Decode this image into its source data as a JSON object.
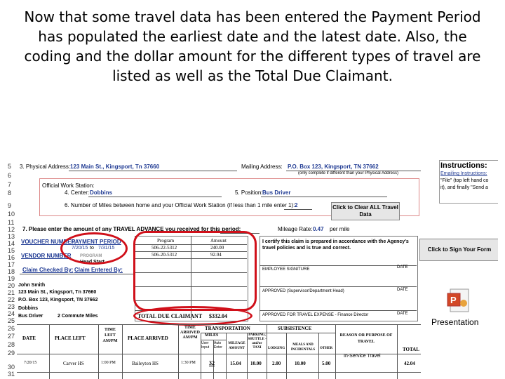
{
  "caption": "Now that some travel data has been entered the Payment Period has populated the earliest date and the latest date. Also, the coding and the dollar amount for the different types of travel are listed as well as the Total Due Claimant.",
  "rows": [
    "5",
    "6",
    "7",
    "8",
    "9",
    "10",
    "11",
    "12",
    "13",
    "14",
    "15",
    "16",
    "17",
    "18",
    "19",
    "20",
    "21",
    "22",
    "23",
    "24",
    "25",
    "26",
    "27",
    "28",
    "29",
    "30",
    "31"
  ],
  "form": {
    "physical_address_label": "3. Physical Address:",
    "physical_address_value": "123 Main St., Kingsport, Tn 37660",
    "mailing_address_label": "Mailing Address:",
    "mailing_address_value": "P.O. Box 123, Kingsport, TN 37662",
    "mailing_note": "(only complete if different than your Physical Address)",
    "official_station": "Official Work Station:",
    "center_label": "4. Center:",
    "center_value": "Dobbins",
    "position_label": "5. Position:",
    "position_value": "Bus Driver",
    "miles_label": "6. Number of Miles between home and your Official Work Station (if less than 1 mile enter 1):",
    "miles_value": "2",
    "advance_label": "7. Please enter the amount of any TRAVEL ADVANCE you received for this period:",
    "mileage_rate_label": "Mileage Rate:",
    "mileage_rate_value": "0.47",
    "per_mile": "per mile"
  },
  "instructions": {
    "title": "Instructions:",
    "emailing": "Emailing Instructions:",
    "line2": "\"File\" (top left hand co",
    "line3": "it), and finally \"Send a"
  },
  "buttons": {
    "clear": "Click to Clear ALL Travel Data",
    "sign": "Click to Sign Your Form"
  },
  "left_panel": {
    "voucher_number": "VOUCHER NUMBER",
    "payment_period": "PAYMENT PERIOD",
    "date_from": "7/20/15",
    "to": "to",
    "date_to": "7/31/15",
    "vendor_number": "VENDOR NUMBER",
    "program_hidden": "PROGRAM",
    "head_start": "Head Start",
    "claim_checked_by": "Claim Checked By:",
    "claim_entered_by": "Claim Entered By:",
    "name": "John Smith",
    "address1": "123 Main St., Kingsport, Tn 37660",
    "address2": "P.O. Box 123, Kingsport, TN 37662",
    "center": "Dobbins",
    "position": "Bus Driver",
    "commute": "2 Commute Miles"
  },
  "coding": {
    "program_header": "Program",
    "amount_header": "Amount",
    "rows": [
      {
        "program": "506-22-5312",
        "amount": "240.00"
      },
      {
        "program": "506-20-5312",
        "amount": "92.04"
      }
    ],
    "total_label": "TOTAL DUE CLAIMANT",
    "total_value": "$332.04"
  },
  "certify": {
    "text": "I certify this claim is prepared in accordance with the Agency's travel policies and is true and correct.",
    "sig1": "EMPLOYEE SIGNITURE",
    "sig2": "APPROVED (Supervisor/Department Head)",
    "sig3": "APPROVED FOR TRAVEL EXPENSE - Finance Director",
    "date": "DATE"
  },
  "presentation": {
    "label": "Presentation"
  },
  "travel_table": {
    "headers": {
      "date": "DATE",
      "place_left": "PLACE LEFT",
      "time_left": "TIME LEFT AM/PM",
      "place_arrived": "PLACE ARRIVED",
      "time_arrived": "TIME ARRIVED AM/PM",
      "transportation": "TRANSPORTATION",
      "miles": "MILES",
      "user_input": "User Input",
      "auto_enter": "Auto Enter",
      "mileage_amount": "MILEAGE AMOUNT",
      "parking": "PARKING, SHUTTLE - and/or TAXI",
      "subsistence": "SUBSISTENCE",
      "lodging": "LODGING",
      "meals": "MEALS AND INCIDENTALS",
      "other": "OTHER",
      "reason": "REASON OR PURPOSE OF TRAVEL",
      "total": "TOTAL"
    },
    "row": {
      "date": "7/20/15",
      "place_left": "Carver HS",
      "time_left": "1:00 PM",
      "place_arrived": "Baileyton HS",
      "time_arrived": "1:30 PM",
      "miles": "32",
      "mileage_amount": "15.04",
      "parking": "10.00",
      "lodging": "2.00",
      "meals": "10.00",
      "other": "5.00",
      "reason": "In-Service Travel",
      "total": "42.04"
    }
  }
}
